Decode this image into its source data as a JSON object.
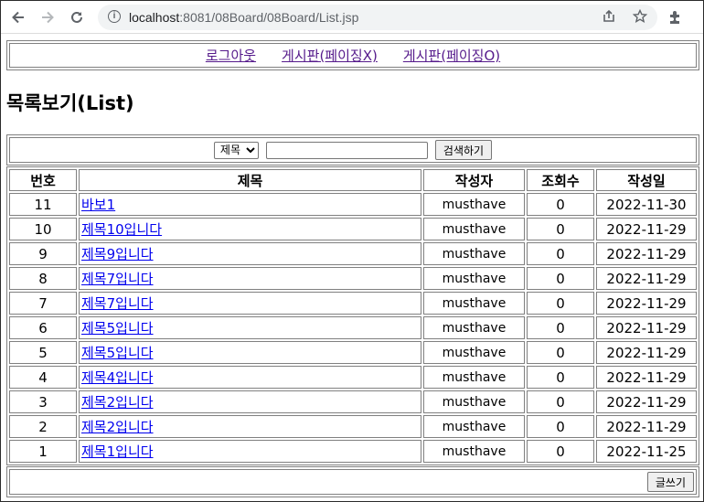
{
  "browser": {
    "url_host": "localhost",
    "url_path": ":8081/08Board/08Board/List.jsp"
  },
  "menu": {
    "links": [
      "로그아웃",
      "게시판(페이징X)",
      "게시판(페이징O)"
    ]
  },
  "page_title": "목록보기(List)",
  "search": {
    "field_options": [
      "제목"
    ],
    "selected_field": "제목",
    "keyword": "",
    "button_label": "검색하기"
  },
  "table": {
    "headers": {
      "num": "번호",
      "title": "제목",
      "writer": "작성자",
      "visits": "조회수",
      "date": "작성일"
    },
    "rows": [
      {
        "num": "11",
        "title": "바보1",
        "writer": "musthave",
        "visits": "0",
        "date": "2022-11-30"
      },
      {
        "num": "10",
        "title": "제목10입니다",
        "writer": "musthave",
        "visits": "0",
        "date": "2022-11-29"
      },
      {
        "num": "9",
        "title": "제목9입니다",
        "writer": "musthave",
        "visits": "0",
        "date": "2022-11-29"
      },
      {
        "num": "8",
        "title": "제목7입니다",
        "writer": "musthave",
        "visits": "0",
        "date": "2022-11-29"
      },
      {
        "num": "7",
        "title": "제목7입니다",
        "writer": "musthave",
        "visits": "0",
        "date": "2022-11-29"
      },
      {
        "num": "6",
        "title": "제목5입니다",
        "writer": "musthave",
        "visits": "0",
        "date": "2022-11-29"
      },
      {
        "num": "5",
        "title": "제목5입니다",
        "writer": "musthave",
        "visits": "0",
        "date": "2022-11-29"
      },
      {
        "num": "4",
        "title": "제목4입니다",
        "writer": "musthave",
        "visits": "0",
        "date": "2022-11-29"
      },
      {
        "num": "3",
        "title": "제목2입니다",
        "writer": "musthave",
        "visits": "0",
        "date": "2022-11-29"
      },
      {
        "num": "2",
        "title": "제목2입니다",
        "writer": "musthave",
        "visits": "0",
        "date": "2022-11-29"
      },
      {
        "num": "1",
        "title": "제목1입니다",
        "writer": "musthave",
        "visits": "0",
        "date": "2022-11-25"
      }
    ]
  },
  "footer": {
    "write_button_label": "글쓰기"
  },
  "icons": {
    "back": "back-arrow-icon",
    "forward": "forward-arrow-icon",
    "reload": "reload-icon",
    "site_info": "info-icon",
    "share": "share-icon",
    "bookmark": "star-icon",
    "extensions": "puzzle-icon"
  }
}
